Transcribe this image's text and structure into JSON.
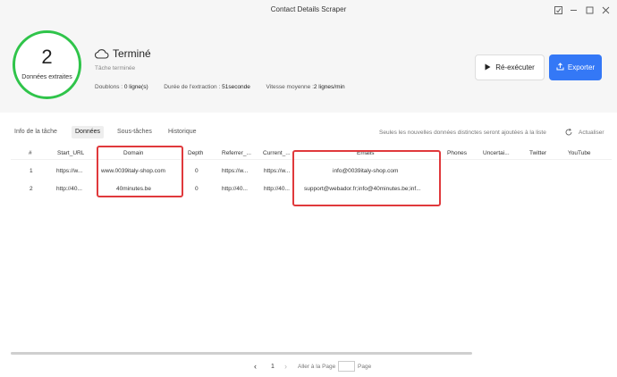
{
  "window": {
    "title": "Contact Details Scraper"
  },
  "summary": {
    "count": "2",
    "count_label": "Données extraites",
    "status": "Terminé",
    "substatus": "Tâche terminée",
    "duplicates_label": "Doublons : ",
    "duplicates_value": "0 ligne(s)",
    "duration_label": "Durée de l'extraction : ",
    "duration_value": "51seconde",
    "speed_label": "Vitesse moyenne :",
    "speed_value": "2 lignes/min"
  },
  "actions": {
    "rerun_label": "Ré-exécuter",
    "export_label": "Exporter"
  },
  "tabs": [
    {
      "label": "Info de la tâche"
    },
    {
      "label": "Données"
    },
    {
      "label": "Sous-tâches"
    },
    {
      "label": "Historique"
    }
  ],
  "info_text": "Seules les nouvelles données distinctes seront ajoutées à la liste",
  "refresh_label": "Actualiser",
  "table": {
    "columns": [
      "#",
      "Start_URL",
      "Domain",
      "Depth",
      "Referrer_...",
      "Current_...",
      "Emails",
      "Phones",
      "Uncertai...",
      "Twitter",
      "YouTube"
    ],
    "rows": [
      [
        "1",
        "https://w...",
        "www.0039italy-shop.com",
        "0",
        "https://w...",
        "https://w...",
        "info@0039italy-shop.com",
        "",
        "",
        "",
        ""
      ],
      [
        "2",
        "http://40...",
        "40minutes.be",
        "0",
        "http://40...",
        "http://40...",
        "support@webador.fr;info@40minutes.be;inf...",
        "",
        "",
        "",
        ""
      ]
    ]
  },
  "pagination": {
    "prev": "‹",
    "current": "1",
    "next": "›",
    "goto_label": "Aller à la Page",
    "page_label": "Page"
  },
  "colors": {
    "accent": "#3478f6",
    "success_ring": "#2fc44a",
    "highlight_box": "#e0393c"
  }
}
